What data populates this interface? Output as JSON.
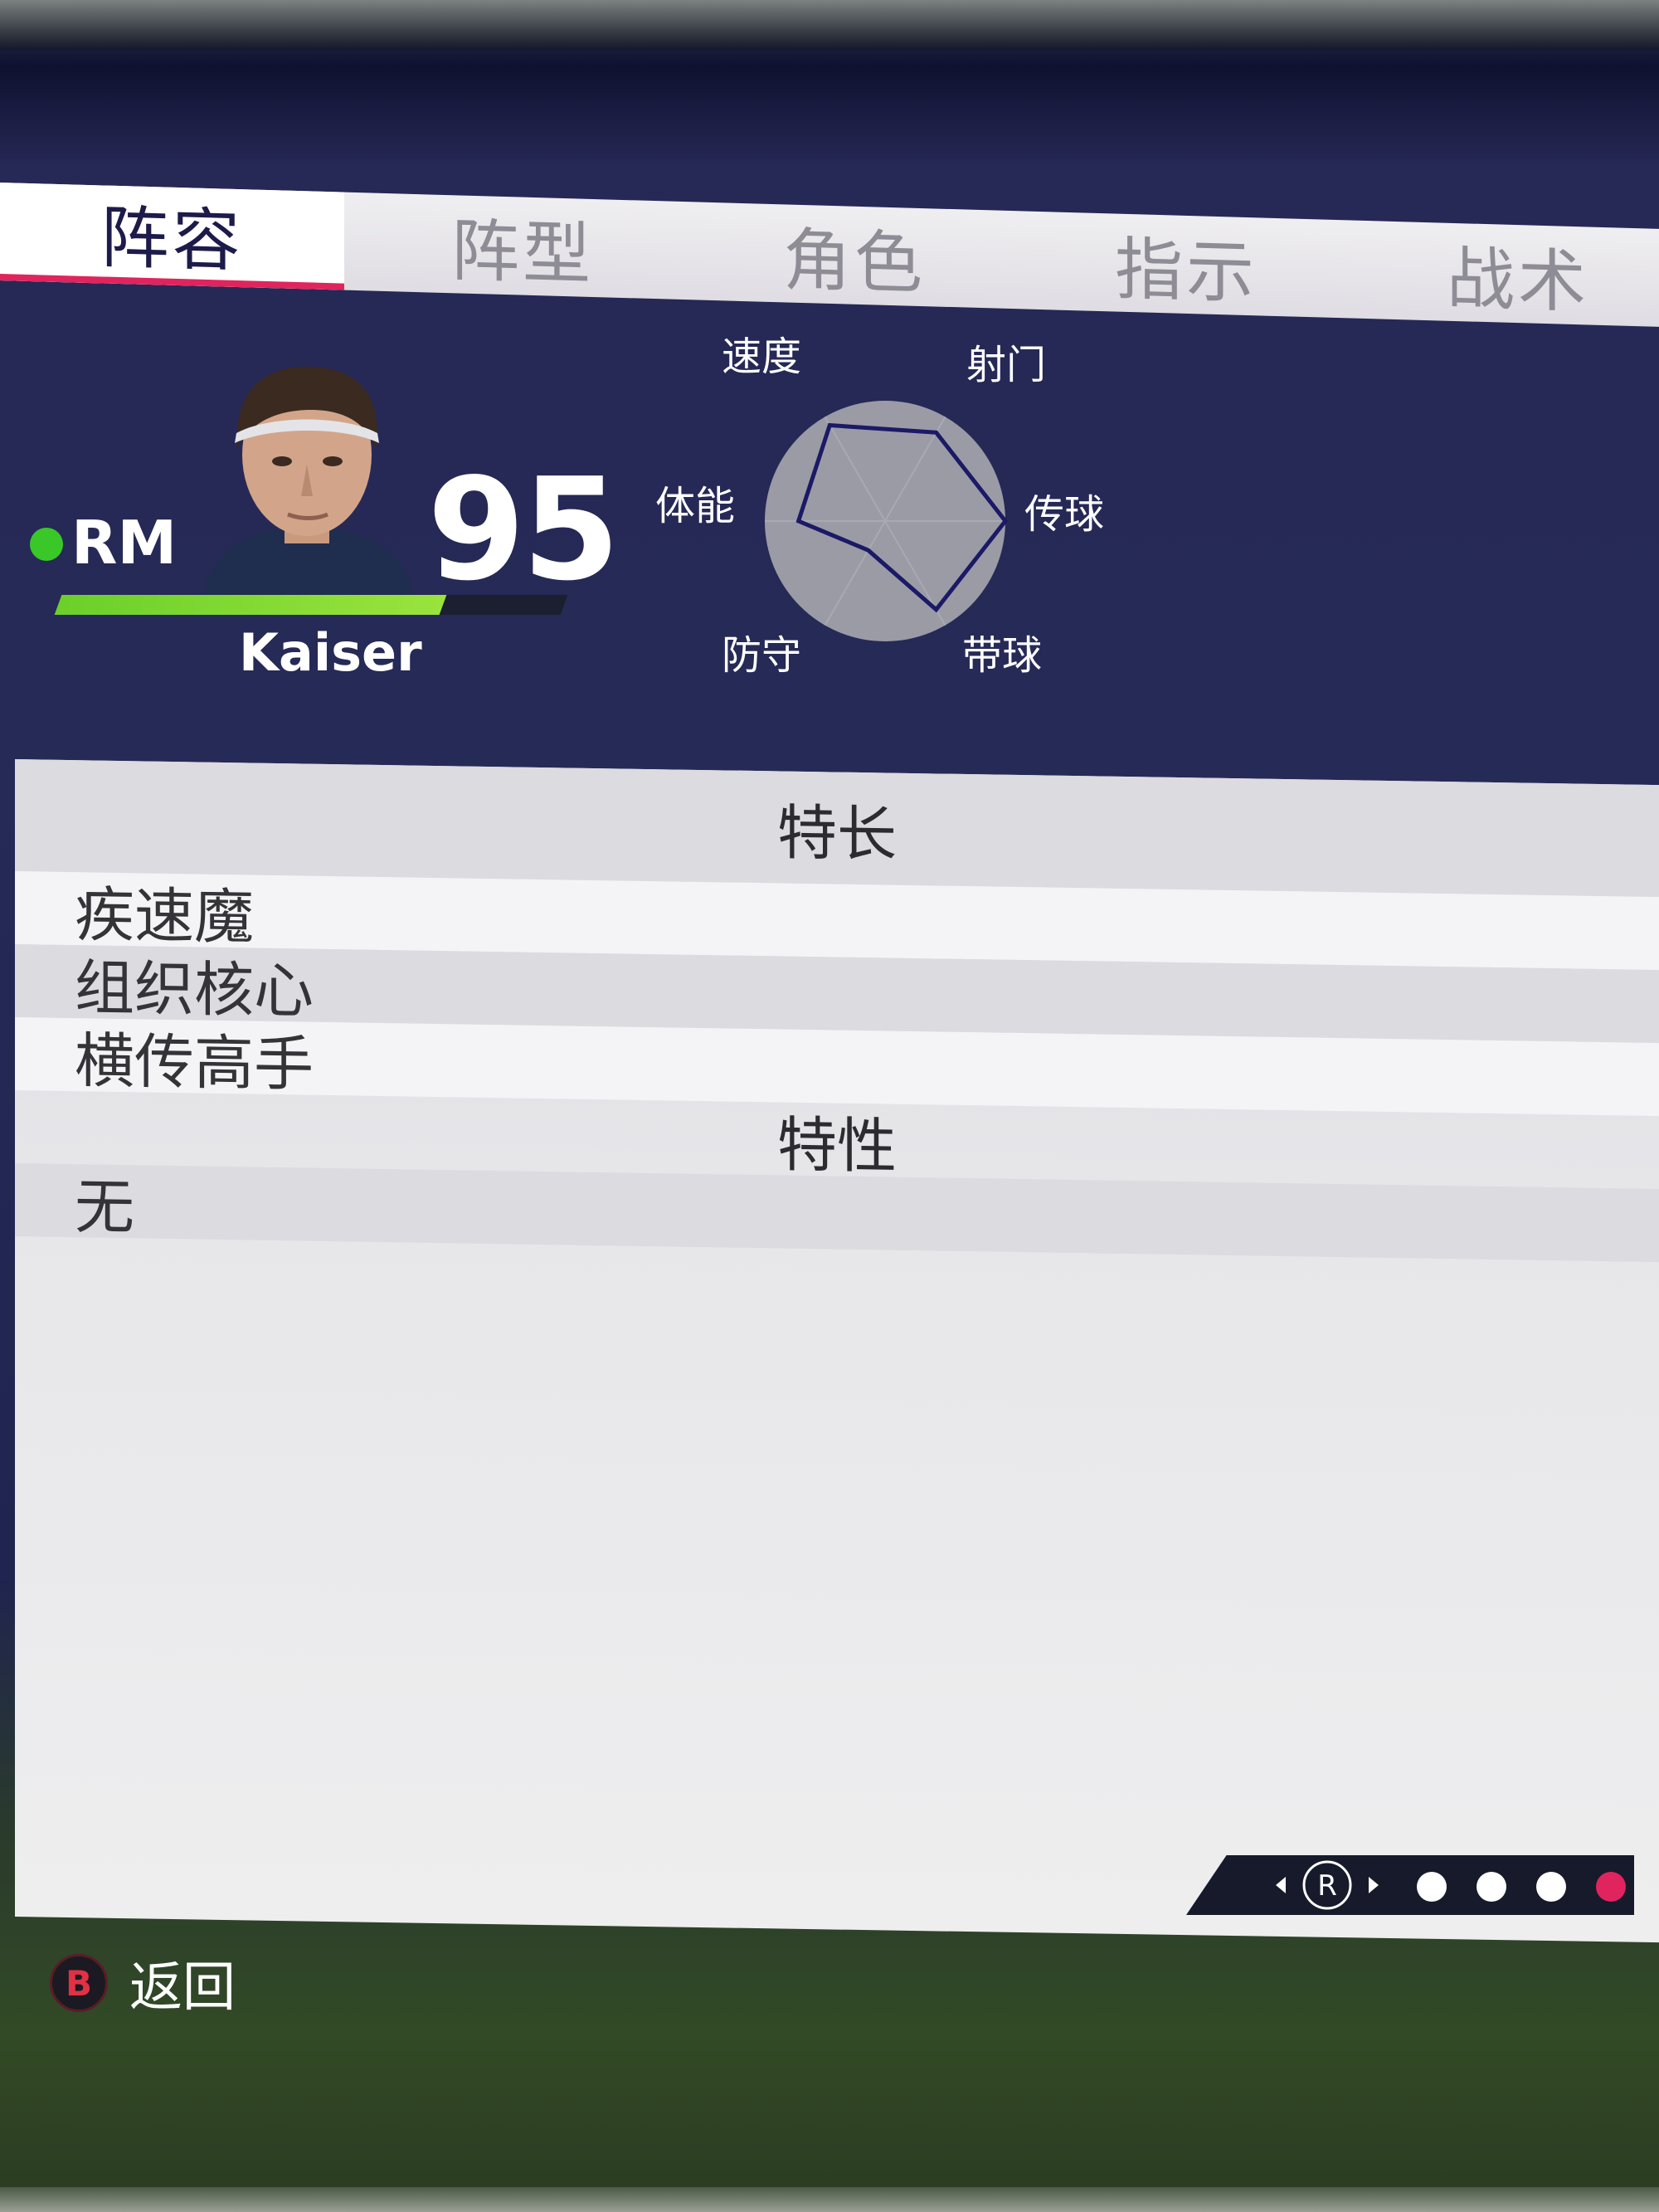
{
  "tabs": [
    {
      "label": "阵容",
      "active": true
    },
    {
      "label": "阵型",
      "active": false
    },
    {
      "label": "角色",
      "active": false
    },
    {
      "label": "指示",
      "active": false
    },
    {
      "label": "战术",
      "active": false
    }
  ],
  "player": {
    "position": "RM",
    "rating": "95",
    "name": "Kaiser",
    "fitness_fraction": 0.76,
    "status_color": "#39c828"
  },
  "radar": {
    "labels": {
      "pace": "速度",
      "shooting": "射门",
      "passing": "传球",
      "dribbling": "带球",
      "defending": "防守",
      "physical": "体能"
    },
    "values": {
      "pace": 0.92,
      "shooting": 0.85,
      "passing": 1.0,
      "dribbling": 0.85,
      "defending": 0.28,
      "physical": 0.72
    }
  },
  "specialties": {
    "title": "特长",
    "items": [
      "疾速魔",
      "组织核心",
      "横传高手"
    ]
  },
  "traits": {
    "title": "特性",
    "items": [
      "无"
    ]
  },
  "pager": {
    "stick_label": "R",
    "active_page": 4,
    "total_pages": 4
  },
  "back": {
    "button_glyph": "B",
    "label": "返回"
  },
  "colors": {
    "accent": "#e0245e",
    "radar_line": "#1c1a66"
  }
}
